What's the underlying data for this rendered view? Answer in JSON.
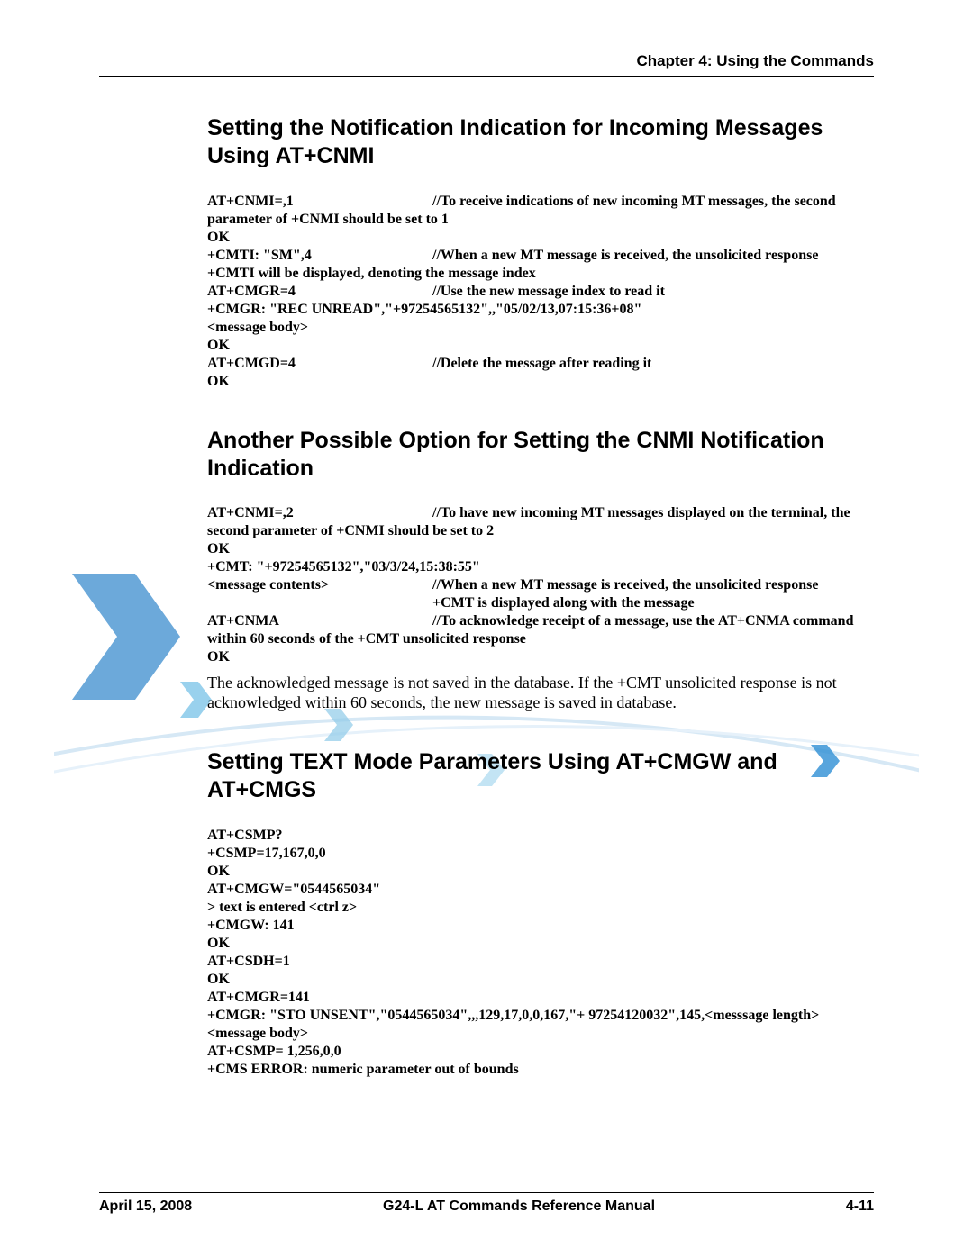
{
  "header": {
    "chapter": "Chapter 4:  Using the Commands"
  },
  "s1": {
    "title": "Setting the Notification Indication for Incoming Messages Using AT+CNMI",
    "l1a": "AT+CNMI=,1",
    "l1b": "//To receive indications of new incoming MT messages, the second",
    "l2": "parameter of +CNMI should be set to 1",
    "l3": "OK",
    "l4a": "+CMTI: \"SM\",4",
    "l4b": "//When a new MT message is received, the unsolicited response",
    "l5": "+CMTI will be displayed, denoting the message index",
    "l6a": "AT+CMGR=4",
    "l6b": "//Use the new message index to read it",
    "l7": "+CMGR: \"REC UNREAD\",\"+97254565132\",,\"05/02/13,07:15:36+08\"",
    "l8": "<message body>",
    "l9": "OK",
    "l10a": "AT+CMGD=4",
    "l10b": "//Delete the message after reading it",
    "l11": "OK"
  },
  "s2": {
    "title": "Another Possible Option for Setting the CNMI Notification Indication",
    "l1a": "AT+CNMI=,2",
    "l1b": "//To have new incoming MT messages displayed on the terminal, the",
    "l2": "second parameter of +CNMI should be set to 2",
    "l3": "OK",
    "l4": "+CMT: \"+97254565132\",\"03/3/24,15:38:55\"",
    "l5a": "<message contents>",
    "l5b": "//When a new MT message is received, the unsolicited response",
    "l6": "+CMT is displayed along with the message",
    "l7a": "AT+CNMA",
    "l7b": "//To acknowledge receipt of a message, use the AT+CNMA command",
    "l8": "within 60 seconds of the +CMT unsolicited response",
    "l9": "OK",
    "para": "The acknowledged message is not saved in the database. If the +CMT unsolicited response is not acknowledged within 60 seconds, the new message is saved in database."
  },
  "s3": {
    "title": "Setting TEXT Mode Parameters Using AT+CMGW and AT+CMGS",
    "l1": "AT+CSMP?",
    "l2": "+CSMP=17,167,0,0",
    "l3": "OK",
    "l4": "AT+CMGW=\"0544565034\"",
    "l5": "> text is entered <ctrl z>",
    "l6": "+CMGW: 141",
    "l7": "OK",
    "l8": "AT+CSDH=1",
    "l9": "OK",
    "l10": "AT+CMGR=141",
    "l11": "+CMGR: \"STO UNSENT\",\"0544565034\",,,129,17,0,0,167,\"+ 97254120032\",145,<messsage length>",
    "l12": "<message body>",
    "l13": "AT+CSMP= 1,256,0,0",
    "l14": "+CMS ERROR: numeric parameter out of bounds"
  },
  "footer": {
    "date": "April 15, 2008",
    "title": "G24-L AT Commands Reference Manual",
    "page": "4-11"
  }
}
